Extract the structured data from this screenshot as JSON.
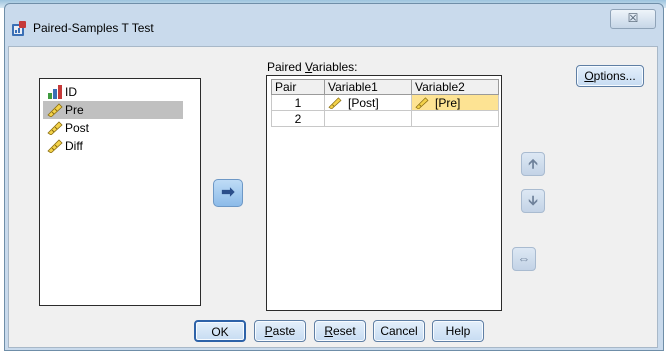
{
  "window": {
    "title": "Paired-Samples T Test",
    "close_glyph": "☒"
  },
  "variables": [
    {
      "label": "ID",
      "icon": "nominal-bar-icon",
      "selected": false
    },
    {
      "label": "Pre",
      "icon": "scale-ruler-icon",
      "selected": true
    },
    {
      "label": "Post",
      "icon": "scale-ruler-icon",
      "selected": false
    },
    {
      "label": "Diff",
      "icon": "scale-ruler-icon",
      "selected": false
    }
  ],
  "paired": {
    "label_prefix": "Paired ",
    "label_accel": "V",
    "label_rest": "ariables:",
    "columns": [
      "Pair",
      "Variable1",
      "Variable2"
    ],
    "rows": [
      {
        "pair": "1",
        "v1": "[Post]",
        "v2": "[Pre]"
      },
      {
        "pair": "2",
        "v1": "",
        "v2": ""
      }
    ]
  },
  "buttons": {
    "options": {
      "accel": "O",
      "rest": "ptions..."
    },
    "ok": "OK",
    "paste": {
      "accel": "P",
      "rest": "aste"
    },
    "reset": {
      "accel": "R",
      "rest": "eset"
    },
    "cancel": "Cancel",
    "help": "Help"
  },
  "colors": {
    "selection": "#c0c0c0",
    "highlight_cell": "#fde393",
    "window_frame": "#c9daec",
    "accent_button": "#2d62a8"
  },
  "glyphs": {
    "transfer": "➡",
    "up": "🡩",
    "down": "🡫",
    "swap": "⇔"
  }
}
